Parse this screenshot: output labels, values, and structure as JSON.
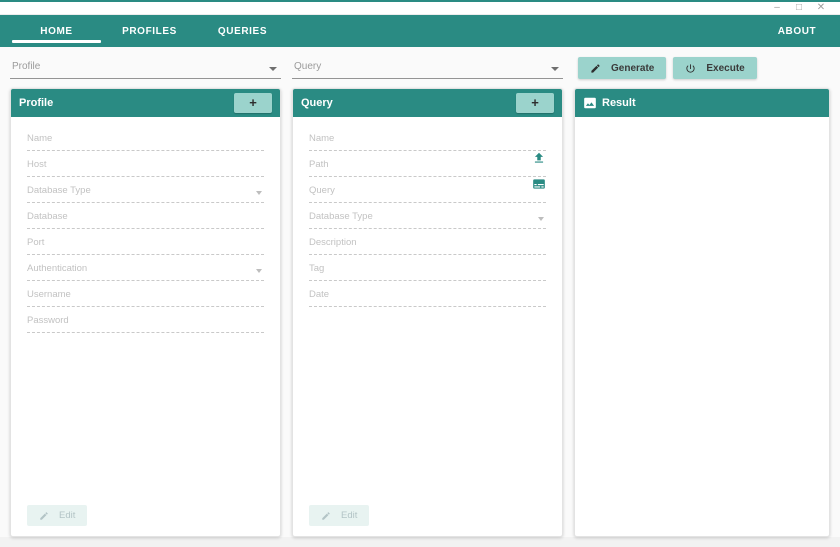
{
  "window": {
    "minimize_glyph": "–",
    "maximize_glyph": "□",
    "close_glyph": "✕"
  },
  "nav": {
    "tabs": [
      {
        "label": "HOME",
        "active": true
      },
      {
        "label": "PROFILES",
        "active": false
      },
      {
        "label": "QUERIES",
        "active": false
      }
    ],
    "about_label": "ABOUT"
  },
  "toolbar": {
    "profile_select_placeholder": "Profile",
    "query_select_placeholder": "Query",
    "generate_label": "Generate",
    "execute_label": "Execute"
  },
  "profile_card": {
    "title": "Profile",
    "add_label": "+",
    "fields": [
      {
        "label": "Name",
        "type": "text"
      },
      {
        "label": "Host",
        "type": "text"
      },
      {
        "label": "Database Type",
        "type": "select"
      },
      {
        "label": "Database",
        "type": "text"
      },
      {
        "label": "Port",
        "type": "text"
      },
      {
        "label": "Authentication",
        "type": "select"
      },
      {
        "label": "Username",
        "type": "text"
      },
      {
        "label": "Password",
        "type": "text"
      }
    ],
    "edit_label": "Edit"
  },
  "query_card": {
    "title": "Query",
    "add_label": "+",
    "fields": [
      {
        "label": "Name",
        "type": "text"
      },
      {
        "label": "Path",
        "type": "text",
        "icon": "upload-icon"
      },
      {
        "label": "Query",
        "type": "text",
        "icon": "subtitles-icon"
      },
      {
        "label": "Database Type",
        "type": "select"
      },
      {
        "label": "Description",
        "type": "text"
      },
      {
        "label": "Tag",
        "type": "text"
      },
      {
        "label": "Date",
        "type": "text"
      }
    ],
    "edit_label": "Edit"
  },
  "result_card": {
    "title": "Result",
    "icon": "image-icon"
  },
  "colors": {
    "teal": "#2a8b83",
    "light_teal": "#9bd3cc",
    "page_bg": "#fafafa",
    "disabled_btn_bg": "#e8f3f1",
    "field_label": "#c2c2c2"
  }
}
